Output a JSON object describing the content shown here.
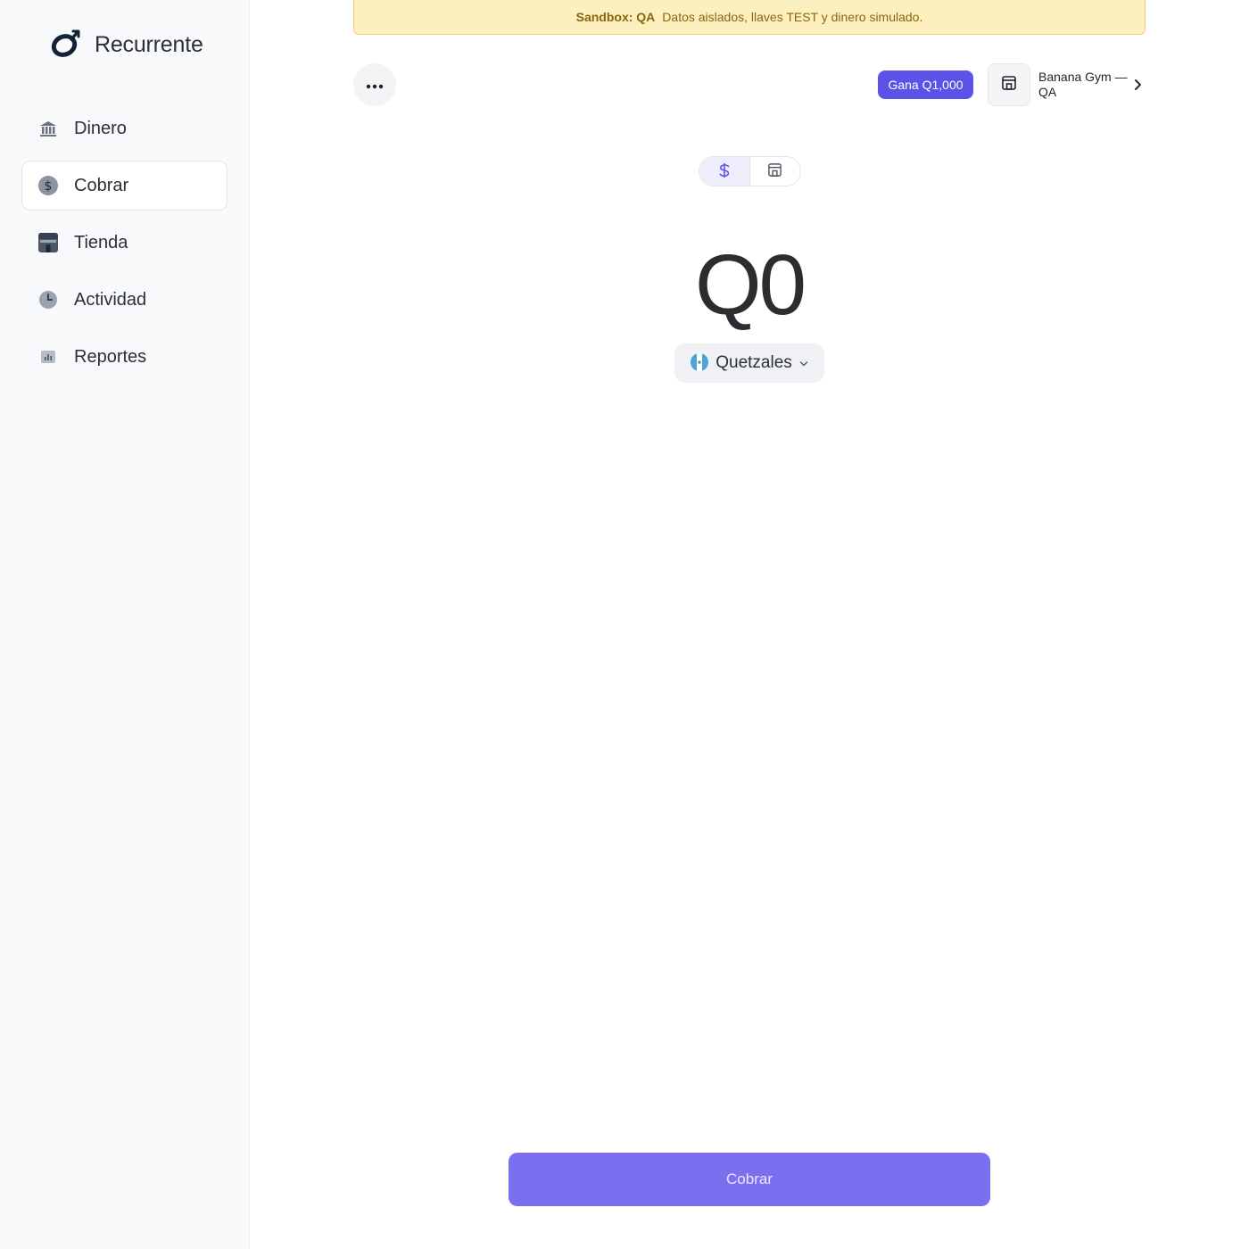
{
  "brand": {
    "name": "Recurrente",
    "logo_icon": "recurrente-logo-icon"
  },
  "sidebar": {
    "items": [
      {
        "label": "Dinero",
        "icon": "bank-icon",
        "active": false
      },
      {
        "label": "Cobrar",
        "icon": "dollar-circle-icon",
        "active": true
      },
      {
        "label": "Tienda",
        "icon": "store-icon",
        "active": false
      },
      {
        "label": "Actividad",
        "icon": "clock-icon",
        "active": false
      },
      {
        "label": "Reportes",
        "icon": "report-icon",
        "active": false
      }
    ]
  },
  "banner": {
    "strong": "Sandbox: QA",
    "text": "Datos aislados, llaves TEST y dinero simulado.",
    "bg_color": "#fdf0bf",
    "text_color": "#8a6510"
  },
  "topbar": {
    "earn_label": "Gana Q1,000",
    "merchant_name": "Banana Gym — QA",
    "accent_color": "#5b52e8"
  },
  "mode_toggle": {
    "options": [
      {
        "icon": "dollar-icon",
        "active": true
      },
      {
        "icon": "storefront-icon",
        "active": false
      }
    ]
  },
  "amount": {
    "display": "Q0"
  },
  "currency": {
    "label": "Quetzales",
    "flag_icon": "guatemala-flag-icon"
  },
  "actions": {
    "charge_label": "Cobrar",
    "charge_color": "#7b6ff0"
  }
}
